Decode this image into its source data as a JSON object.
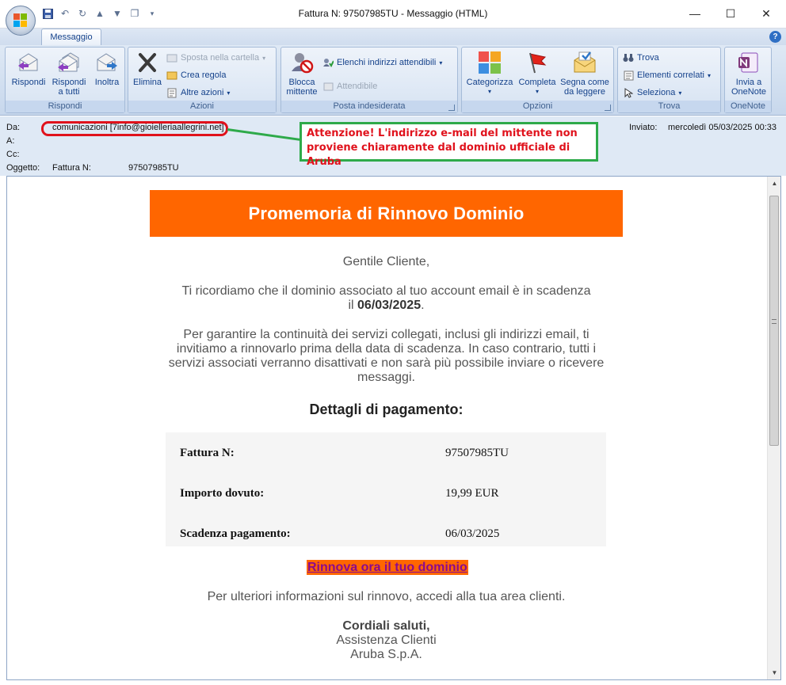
{
  "window": {
    "title": "Fattura N: 97507985TU - Messaggio (HTML)",
    "minimize": "—",
    "maximize": "☐",
    "close": "✕"
  },
  "ribbon": {
    "tab": "Messaggio",
    "groups": {
      "rispondi": {
        "label": "Rispondi",
        "reply": "Rispondi",
        "reply_all_1": "Rispondi",
        "reply_all_2": "a tutti",
        "forward": "Inoltra"
      },
      "azioni": {
        "label": "Azioni",
        "delete": "Elimina",
        "move": "Sposta nella cartella",
        "create_rule": "Crea regola",
        "other_actions": "Altre azioni"
      },
      "posta": {
        "label": "Posta indesiderata",
        "block_1": "Blocca",
        "block_2": "mittente",
        "safe_lists": "Elenchi indirizzi attendibili",
        "trusted": "Attendibile"
      },
      "opzioni": {
        "label": "Opzioni",
        "categorize": "Categorizza",
        "followup": "Completa",
        "mark_unread_1": "Segna come",
        "mark_unread_2": "da leggere"
      },
      "trova": {
        "label": "Trova",
        "find": "Trova",
        "related": "Elementi correlati",
        "select": "Seleziona"
      },
      "onenote": {
        "label": "OneNote",
        "send_1": "Invia a",
        "send_2": "OneNote"
      }
    }
  },
  "header": {
    "from_label": "Da:",
    "from_value": "comunicazioni [7info@gioielleriaallegrini.net]",
    "to_label": "A:",
    "cc_label": "Cc:",
    "subject_label": "Oggetto:",
    "subject_prefix": "Fattura N:",
    "subject_number": "97507985TU",
    "sent_label": "Inviato:",
    "sent_value": "mercoledì 05/03/2025 00:33"
  },
  "annotation": {
    "line1": "Attenzione! L'indirizzo e-mail del mittente non",
    "line2": "proviene chiaramente dal dominio ufficiale di Aruba"
  },
  "email": {
    "banner": "Promemoria di Rinnovo Dominio",
    "greeting": "Gentile Cliente,",
    "p1_line1": "Ti ricordiamo che il dominio associato al tuo account email è in scadenza",
    "p1_prefix": "il ",
    "p1_date": "06/03/2025",
    "p1_suffix": ".",
    "p2_line1": "Per garantire la continuità dei servizi collegati, inclusi gli indirizzi email, ti",
    "p2_line2": "invitiamo a rinnovarlo prima della data di scadenza. In caso contrario, tutti i",
    "p2_line3": "servizi associati verranno disattivati e non sarà più possibile inviare o ricevere",
    "p2_line4": "messaggi.",
    "details_title": "Dettagli di pagamento:",
    "payment": [
      {
        "key": "Fattura N:",
        "value": "97507985TU"
      },
      {
        "key": "Importo dovuto:",
        "value": "19,99 EUR"
      },
      {
        "key": "Scadenza pagamento:",
        "value": "06/03/2025"
      }
    ],
    "cta": "Rinnova ora il tuo dominio",
    "info": "Per ulteriori informazioni sul rinnovo, accedi alla tua area clienti.",
    "regards": "Cordiali saluti,",
    "sign1": "Assistenza Clienti",
    "sign2": "Aruba S.p.A."
  },
  "colors": {
    "banner": "#ff6600",
    "warning_red": "#e0121c",
    "warning_green": "#2eaa4a"
  }
}
